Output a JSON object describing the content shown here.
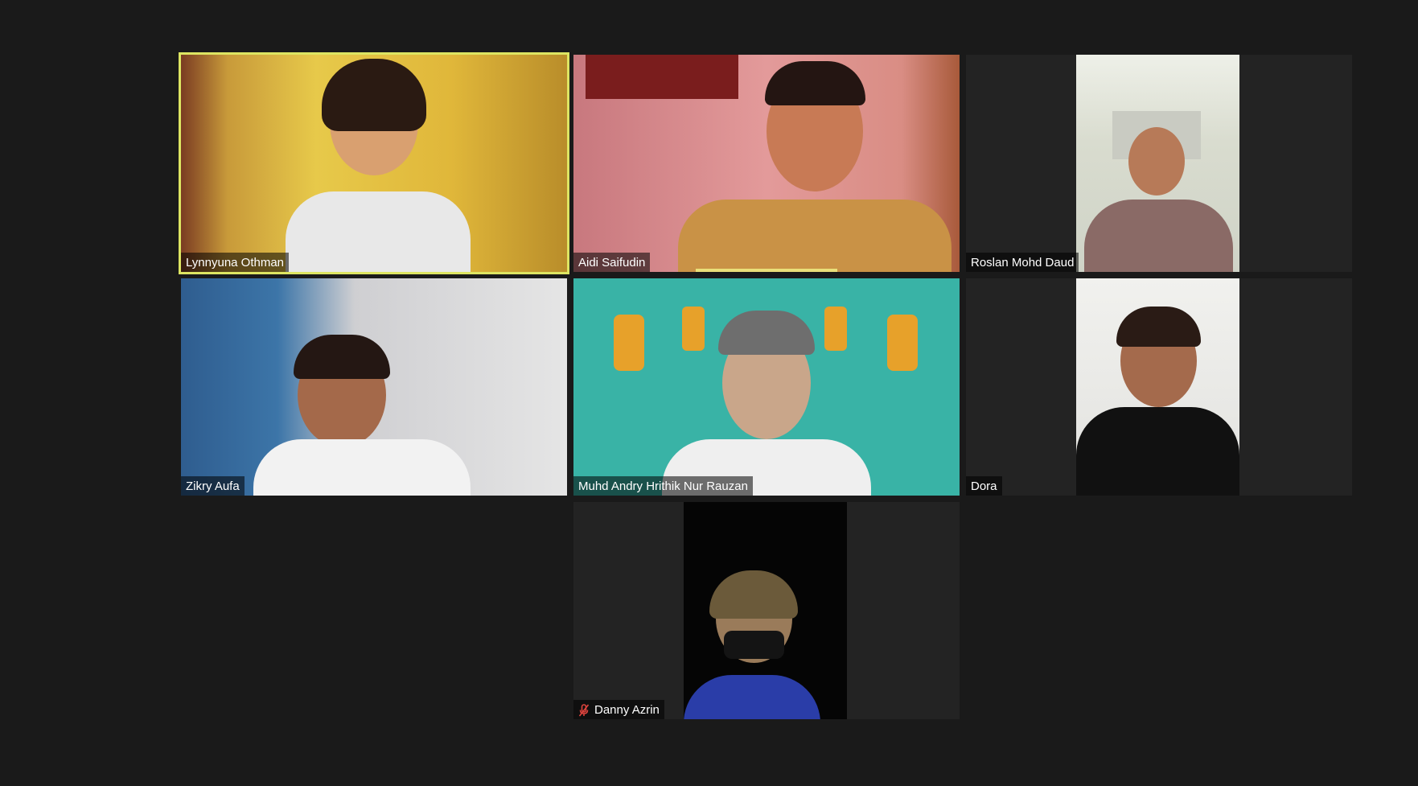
{
  "participants": [
    {
      "name": "Lynnyuna Othman",
      "active_speaker": true
    },
    {
      "name": "Aidi Saifudin"
    },
    {
      "name": "Roslan Mohd Daud"
    },
    {
      "name": "Zikry Aufa"
    },
    {
      "name": "Muhd Andry Hrithik Nur Rauzan"
    },
    {
      "name": "Dora"
    },
    {
      "name": "Danny Azrin",
      "muted": true
    }
  ],
  "colors": {
    "background": "#1a1a1a",
    "tile": "#232323",
    "active_border": "#dde562",
    "muted_icon": "#e0443e"
  }
}
